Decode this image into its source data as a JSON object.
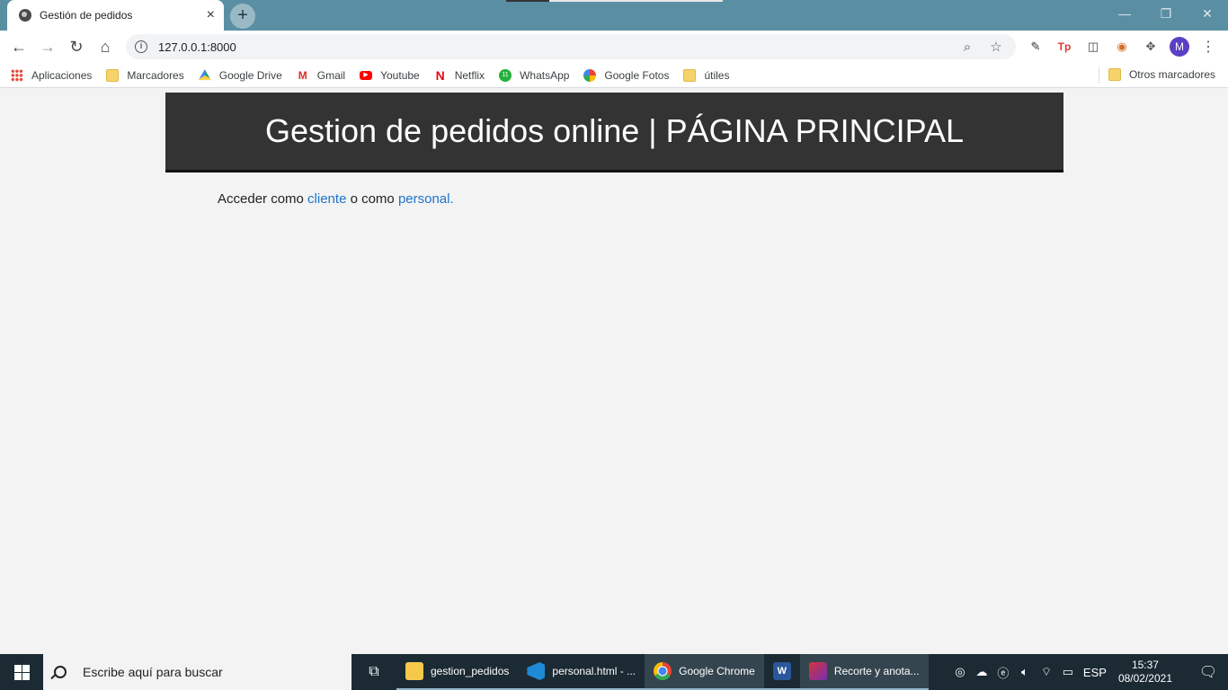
{
  "browser": {
    "tab_title": "Gestión de pedidos",
    "url": "127.0.0.1:8000",
    "window_controls": {
      "minimize": "—",
      "restore": "❐",
      "close": "✕"
    }
  },
  "bookmarks": {
    "items": [
      {
        "label": "Aplicaciones",
        "icon": "apps-grid-icon"
      },
      {
        "label": "Marcadores",
        "icon": "folder-icon"
      },
      {
        "label": "Google Drive",
        "icon": "google-drive-icon"
      },
      {
        "label": "Gmail",
        "icon": "gmail-icon"
      },
      {
        "label": "Youtube",
        "icon": "youtube-icon"
      },
      {
        "label": "Netflix",
        "icon": "netflix-icon"
      },
      {
        "label": "WhatsApp",
        "icon": "whatsapp-icon"
      },
      {
        "label": "Google Fotos",
        "icon": "google-photos-icon"
      },
      {
        "label": "útiles",
        "icon": "folder-icon"
      }
    ],
    "other": "Otros marcadores"
  },
  "page": {
    "header_title": "Gestion de pedidos online | PÁGINA PRINCIPAL",
    "intro_before": "Acceder como ",
    "link_cliente": "cliente",
    "intro_middle": " o como ",
    "link_personal": "personal."
  },
  "taskbar": {
    "search_placeholder": "Escribe aquí para buscar",
    "apps": [
      {
        "label": "gestion_pedidos",
        "icon": "file-explorer-icon"
      },
      {
        "label": "personal.html - ...",
        "icon": "vscode-icon"
      },
      {
        "label": "Google Chrome",
        "icon": "chrome-icon"
      },
      {
        "label": "",
        "icon": "word-icon"
      },
      {
        "label": "Recorte y anota...",
        "icon": "snip-sketch-icon"
      }
    ],
    "language": "ESP",
    "time": "15:37",
    "date": "08/02/2021"
  },
  "colors": {
    "titlebar": "#5a8fa3",
    "header_bg": "#333333",
    "link": "#1e73c8",
    "taskbar": "#1b2a33"
  }
}
